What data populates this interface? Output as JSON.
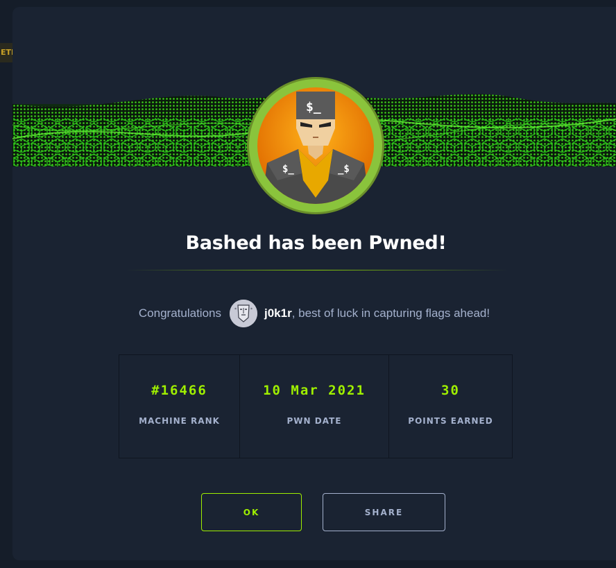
{
  "background": {
    "badge_text": "ETI"
  },
  "modal": {
    "title": "Bashed has been Pwned!",
    "congrats_prefix": "Congratulations",
    "username": "j0k1r",
    "congrats_suffix": ", best of luck in capturing flags ahead!",
    "stats": [
      {
        "value": "#16466",
        "label": "MACHINE RANK"
      },
      {
        "value": "10 Mar 2021",
        "label": "PWN DATE"
      },
      {
        "value": "30",
        "label": "POINTS EARNED"
      }
    ],
    "buttons": {
      "ok_label": "OK",
      "share_label": "SHARE"
    }
  },
  "colors": {
    "accent": "#9fef00",
    "modal_bg": "#1a2332",
    "muted_text": "#a4b1cd"
  }
}
